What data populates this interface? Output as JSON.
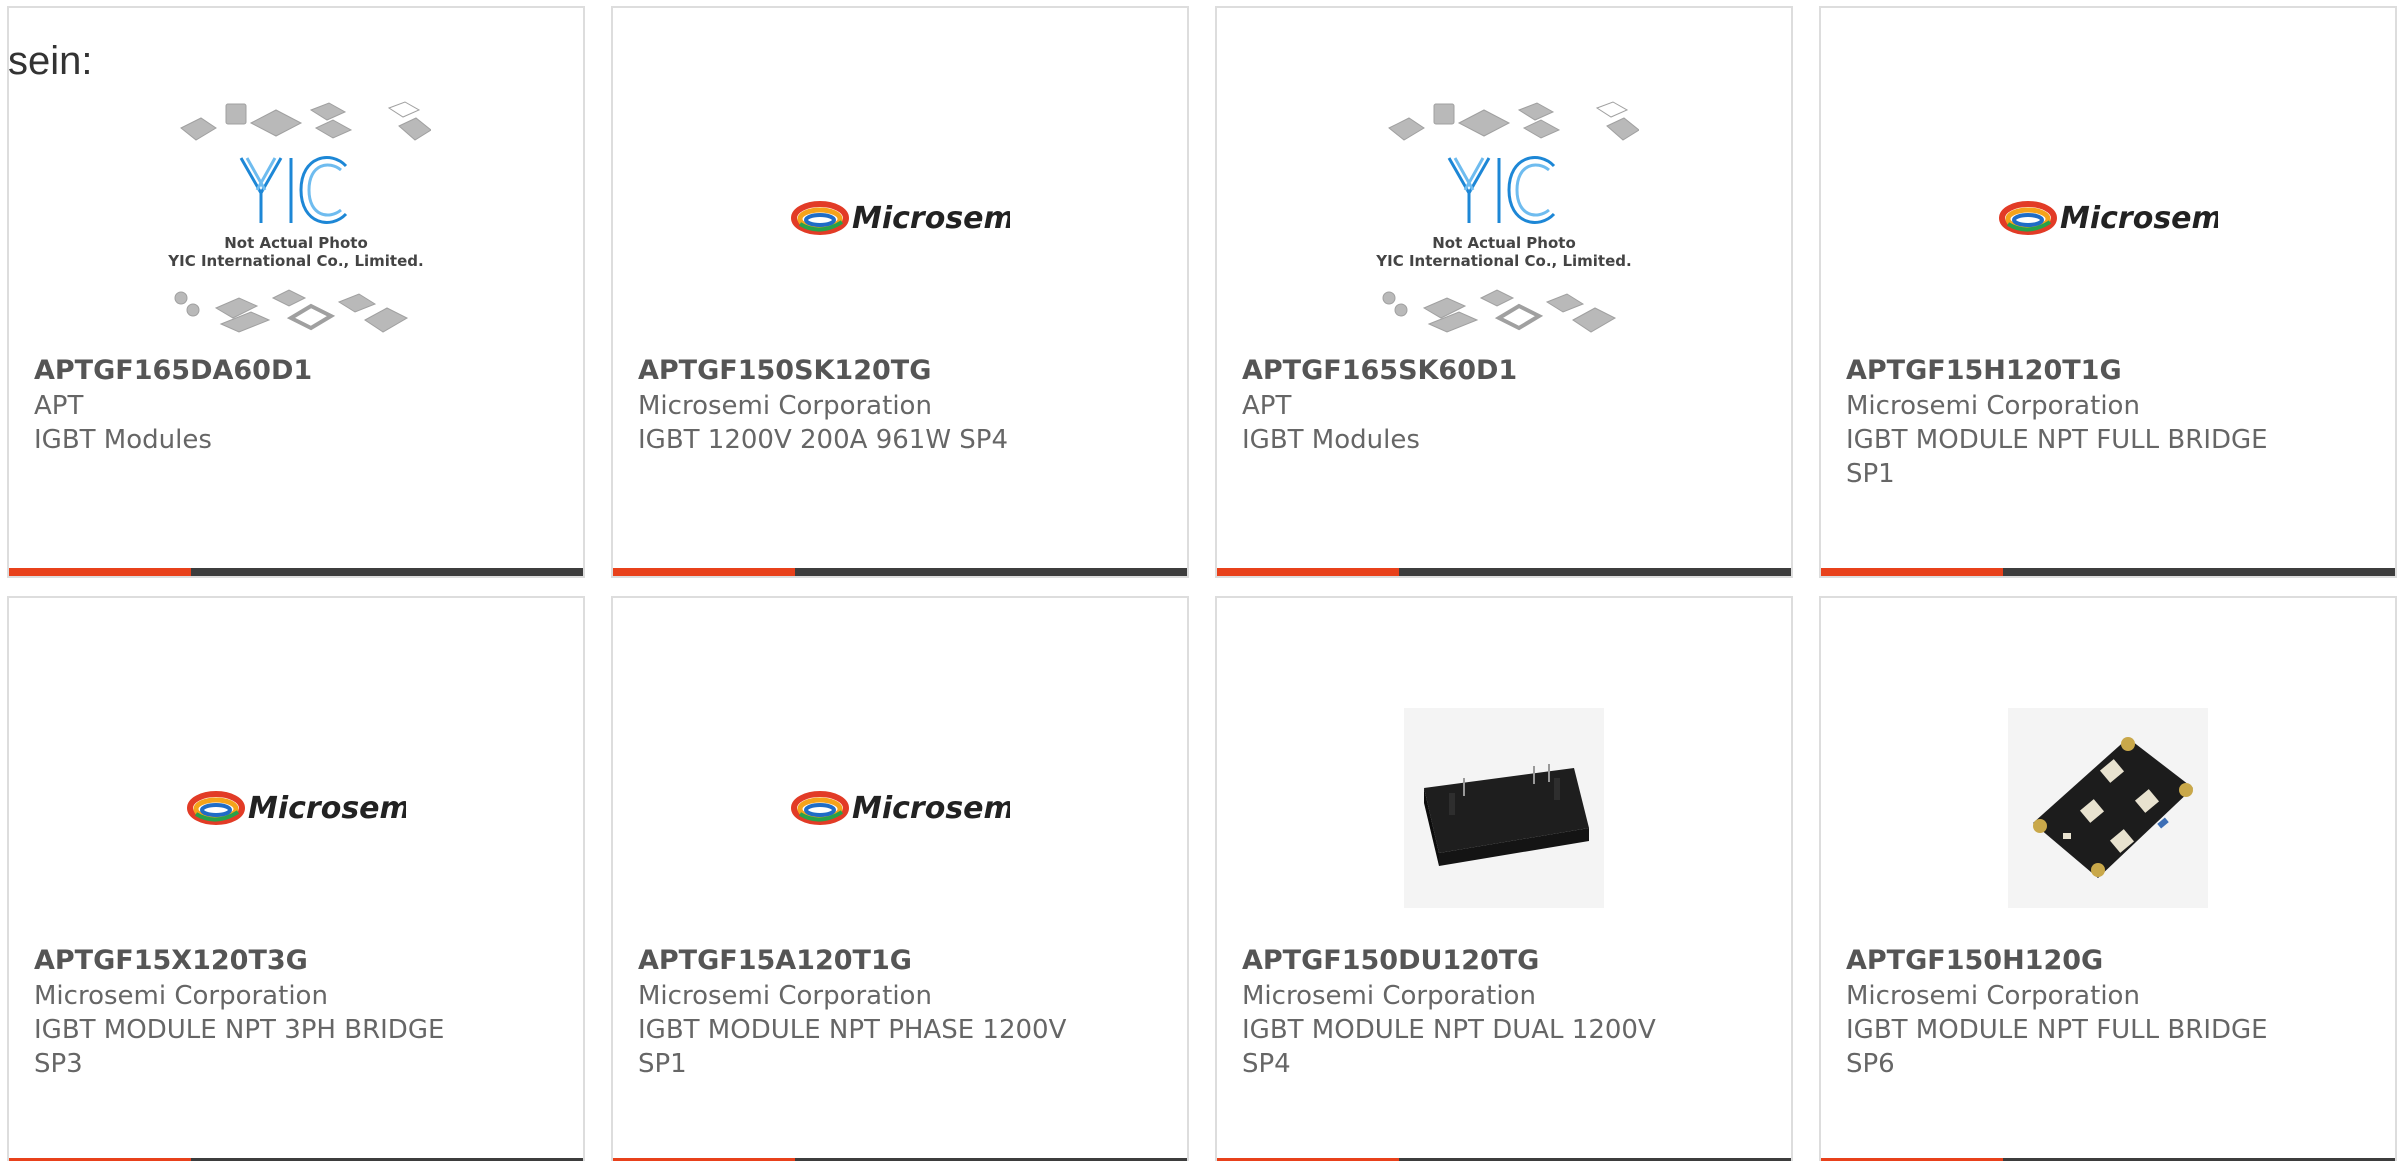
{
  "intro_text": "sein:",
  "colors": {
    "accent": "#e8411b",
    "bar": "#3d3d3d",
    "border": "#dddddd",
    "text": "#666666"
  },
  "products": [
    {
      "part": "APTGF165DA60D1",
      "manufacturer": "APT",
      "description": "IGBT Modules",
      "image": "yic-placeholder",
      "placeholder_caption_1": "Not Actual Photo",
      "placeholder_caption_2": "YIC International Co., Limited."
    },
    {
      "part": "APTGF150SK120TG",
      "manufacturer": "Microsemi Corporation",
      "description": "IGBT 1200V 200A 961W SP4",
      "image": "microsemi-logo",
      "logo_text": "Microsemi"
    },
    {
      "part": "APTGF165SK60D1",
      "manufacturer": "APT",
      "description": "IGBT Modules",
      "image": "yic-placeholder",
      "placeholder_caption_1": "Not Actual Photo",
      "placeholder_caption_2": "YIC International Co., Limited."
    },
    {
      "part": "APTGF15H120T1G",
      "manufacturer": "Microsemi Corporation",
      "description": "IGBT MODULE NPT FULL BRIDGE SP1",
      "image": "microsemi-logo",
      "logo_text": "Microsemi"
    },
    {
      "part": "APTGF15X120T3G",
      "manufacturer": "Microsemi Corporation",
      "description": "IGBT MODULE NPT 3PH BRIDGE SP3",
      "image": "microsemi-logo",
      "logo_text": "Microsemi"
    },
    {
      "part": "APTGF15A120T1G",
      "manufacturer": "Microsemi Corporation",
      "description": "IGBT MODULE NPT PHASE 1200V SP1",
      "image": "microsemi-logo",
      "logo_text": "Microsemi"
    },
    {
      "part": "APTGF150DU120TG",
      "manufacturer": "Microsemi Corporation",
      "description": "IGBT MODULE NPT DUAL 1200V SP4",
      "image": "module-photo-black"
    },
    {
      "part": "APTGF150H120G",
      "manufacturer": "Microsemi Corporation",
      "description": "IGBT MODULE NPT FULL BRIDGE SP6",
      "image": "module-photo-terminals"
    }
  ]
}
